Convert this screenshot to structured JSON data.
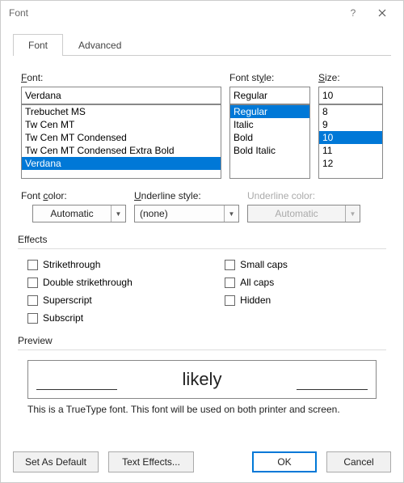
{
  "title": "Font",
  "tabs": {
    "font": "Font",
    "advanced": "Advanced"
  },
  "labels": {
    "font": "Font:",
    "fontStyle": "Font style:",
    "size": "Size:",
    "fontColor": "Font color:",
    "underlineStyle": "Underline style:",
    "underlineColor": "Underline color:",
    "effects": "Effects",
    "preview": "Preview"
  },
  "font": {
    "value": "Verdana",
    "list": [
      "Trebuchet MS",
      "Tw Cen MT",
      "Tw Cen MT Condensed",
      "Tw Cen MT Condensed Extra Bold",
      "Verdana"
    ],
    "selected": "Verdana"
  },
  "style": {
    "value": "Regular",
    "list": [
      "Regular",
      "Italic",
      "Bold",
      "Bold Italic"
    ],
    "selected": "Regular"
  },
  "size": {
    "value": "10",
    "list": [
      "8",
      "9",
      "10",
      "11",
      "12"
    ],
    "selected": "10"
  },
  "fontColor": {
    "value": "Automatic"
  },
  "underlineStyle": {
    "value": "(none)"
  },
  "underlineColor": {
    "value": "Automatic"
  },
  "effects": {
    "strikethrough": "Strikethrough",
    "doubleStrike": "Double strikethrough",
    "superscript": "Superscript",
    "subscript": "Subscript",
    "smallCaps": "Small caps",
    "allCaps": "All caps",
    "hidden": "Hidden"
  },
  "previewText": "likely",
  "hint": "This is a TrueType font. This font will be used on both printer and screen.",
  "buttons": {
    "setDefault": "Set As Default",
    "textEffects": "Text Effects...",
    "ok": "OK",
    "cancel": "Cancel"
  }
}
